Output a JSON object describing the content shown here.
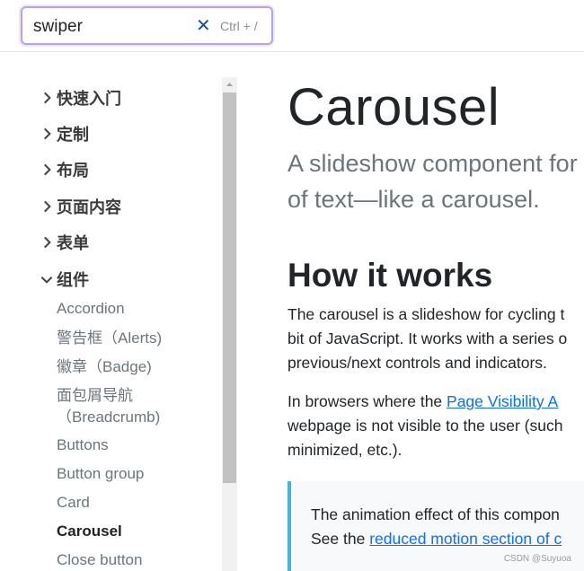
{
  "search": {
    "value": "swiper",
    "clear_symbol": "✕",
    "shortcut": "Ctrl + /"
  },
  "sidebar": {
    "groups": [
      {
        "label": "快速入门",
        "expanded": false
      },
      {
        "label": "定制",
        "expanded": false
      },
      {
        "label": "布局",
        "expanded": false
      },
      {
        "label": "页面内容",
        "expanded": false
      },
      {
        "label": "表单",
        "expanded": false
      },
      {
        "label": "组件",
        "expanded": true
      }
    ],
    "items": [
      {
        "label": "Accordion"
      },
      {
        "label": "警告框（Alerts)"
      },
      {
        "label": "徽章（Badge)"
      },
      {
        "label": "面包屑导航",
        "label2": "（Breadcrumb)"
      },
      {
        "label": "Buttons"
      },
      {
        "label": "Button group"
      },
      {
        "label": "Card"
      },
      {
        "label": "Carousel",
        "active": true
      },
      {
        "label": "Close button"
      }
    ]
  },
  "main": {
    "title": "Carousel",
    "lead_line1": "A slideshow component for",
    "lead_line2": "of text—like a carousel.",
    "section_title": "How it works",
    "p1_line1": "The carousel is a slideshow for cycling t",
    "p1_line2": "bit of JavaScript. It works with a series o",
    "p1_line3": "previous/next controls and indicators.",
    "p2_line1_prefix": "In browsers where the ",
    "p2_line1_link": "Page Visibility A",
    "p2_line2": "webpage is not visible to the user (such",
    "p2_line3": "minimized, etc.).",
    "callout_line1": "The animation effect of this compon",
    "callout_line2_prefix": "See the ",
    "callout_line2_link": "reduced motion section of c"
  },
  "watermark": "CSDN @Suyuoa",
  "colors": {
    "search_focus_border": "#b9a3e6",
    "link": "#0d6efd",
    "callout_border": "#3fb6e0",
    "clear_icon": "#1f4f86"
  },
  "icons": {
    "collapsed": "chevron-right-icon",
    "expanded": "chevron-down-icon",
    "clear": "close-icon"
  }
}
